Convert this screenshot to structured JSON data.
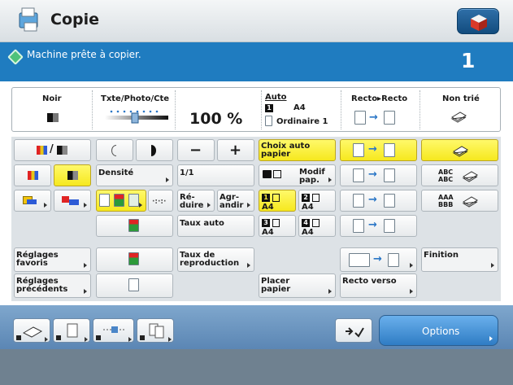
{
  "header": {
    "title": "Copie"
  },
  "status": {
    "message": "Machine prête à copier.",
    "copies": "1"
  },
  "summary": {
    "color_mode": "Noir",
    "image_mode": "Txte/Photo/Cte",
    "ratio": "100 %",
    "paper_mode": "Auto",
    "paper_size": "A4",
    "paper_type": "Ordinaire 1",
    "paper_badge": "1",
    "duplex": "Recto▸Recto",
    "finish": "Non trié"
  },
  "grid": {
    "density_label": "Densité",
    "ratio_1_1": "1/1",
    "reduce": "Ré-\nduire",
    "enlarge": "Agr-\nandir",
    "auto_ratio": "Taux auto",
    "ratio_label": "Taux de\nreproduction",
    "paper_auto": "Choix auto\npapier",
    "paper_modify": "Modif\npap.",
    "tray1": {
      "num": "1",
      "size": "A4"
    },
    "tray2": {
      "num": "2",
      "size": "A4"
    },
    "tray3": {
      "num": "3",
      "size": "A4"
    },
    "tray4": {
      "num": "4",
      "size": "A4"
    },
    "place_paper": "Placer\npapier",
    "duplex_label": "Recto verso",
    "finishing": "Finition",
    "favorites": "Réglages\nfavoris",
    "previous": "Réglages\nprécédents",
    "abc1": "ABC",
    "abc2": "ABC",
    "aaa": "AAA",
    "bbb": "BBB",
    "minus": "−",
    "plus": "+"
  },
  "bottom": {
    "options": "Options"
  },
  "colors": {
    "accent": "#1f7cc0",
    "highlight": "#f6e81e"
  }
}
